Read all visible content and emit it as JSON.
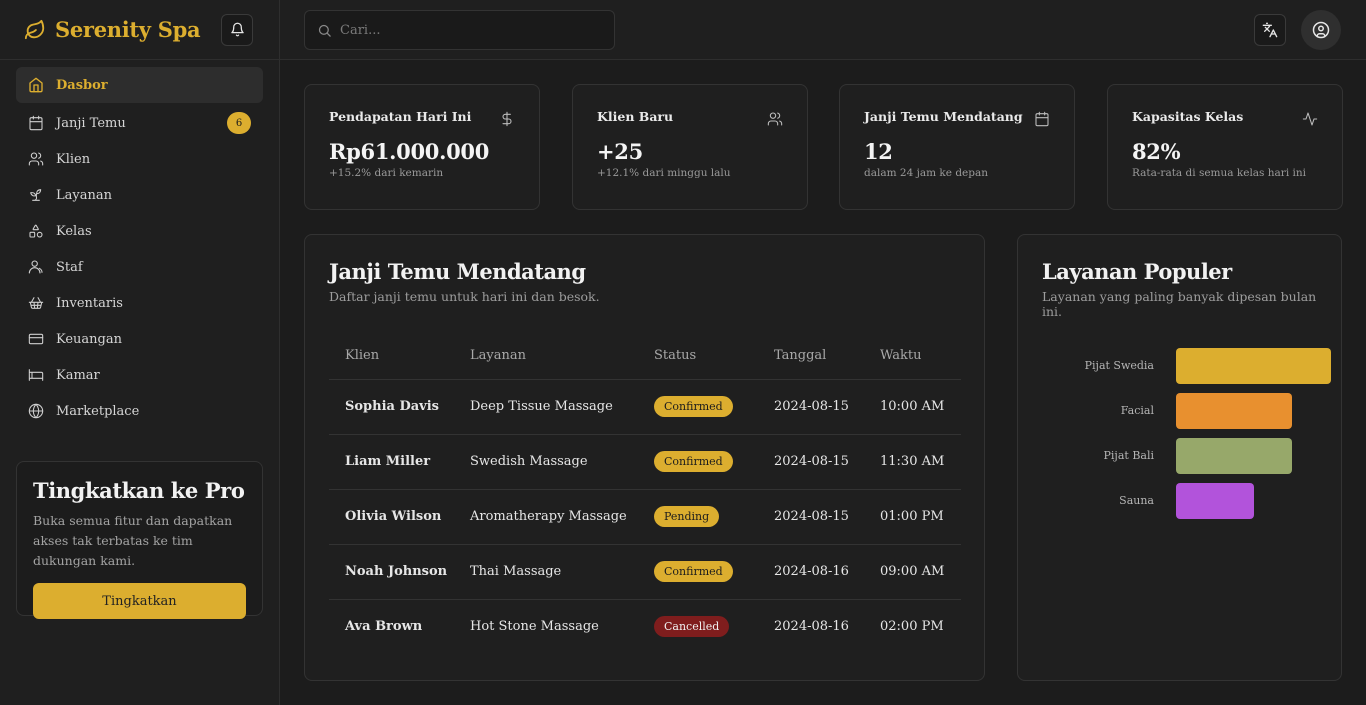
{
  "brand": {
    "name": "Serenity Spa"
  },
  "sidebar": {
    "items": [
      {
        "label": "Dasbor",
        "icon": "home-icon",
        "active": true
      },
      {
        "label": "Janji Temu",
        "icon": "calendar-icon",
        "badge": "6"
      },
      {
        "label": "Klien",
        "icon": "users-icon"
      },
      {
        "label": "Layanan",
        "icon": "sprout-icon"
      },
      {
        "label": "Kelas",
        "icon": "shapes-icon"
      },
      {
        "label": "Staf",
        "icon": "user-icon"
      },
      {
        "label": "Inventaris",
        "icon": "basket-icon"
      },
      {
        "label": "Keuangan",
        "icon": "credit-card-icon"
      },
      {
        "label": "Kamar",
        "icon": "bed-icon"
      },
      {
        "label": "Marketplace",
        "icon": "globe-icon"
      }
    ],
    "pro": {
      "title": "Tingkatkan ke Pro",
      "description": "Buka semua fitur dan dapatkan akses tak terbatas ke tim dukungan kami.",
      "button": "Tingkatkan"
    }
  },
  "topbar": {
    "search_placeholder": "Cari..."
  },
  "stats": [
    {
      "label": "Pendapatan Hari Ini",
      "icon": "dollar-icon",
      "value": "Rp61.000.000",
      "sub": "+15.2% dari kemarin"
    },
    {
      "label": "Klien Baru",
      "icon": "users-icon",
      "value": "+25",
      "sub": "+12.1% dari minggu lalu"
    },
    {
      "label": "Janji Temu Mendatang",
      "icon": "calendar-icon",
      "value": "12",
      "sub": "dalam 24 jam ke depan"
    },
    {
      "label": "Kapasitas Kelas",
      "icon": "activity-icon",
      "value": "82%",
      "sub": "Rata-rata di semua kelas hari ini"
    }
  ],
  "appointments": {
    "title": "Janji Temu Mendatang",
    "description": "Daftar janji temu untuk hari ini dan besok.",
    "columns": [
      "Klien",
      "Layanan",
      "Status",
      "Tanggal",
      "Waktu"
    ],
    "rows": [
      {
        "client": "Sophia Davis",
        "service": "Deep Tissue Massage",
        "status": "Confirmed",
        "date": "2024-08-15",
        "time": "10:00 AM"
      },
      {
        "client": "Liam Miller",
        "service": "Swedish Massage",
        "status": "Confirmed",
        "date": "2024-08-15",
        "time": "11:30 AM"
      },
      {
        "client": "Olivia Wilson",
        "service": "Aromatherapy Massage",
        "status": "Pending",
        "date": "2024-08-15",
        "time": "01:00 PM"
      },
      {
        "client": "Noah Johnson",
        "service": "Thai Massage",
        "status": "Confirmed",
        "date": "2024-08-16",
        "time": "09:00 AM"
      },
      {
        "client": "Ava Brown",
        "service": "Hot Stone Massage",
        "status": "Cancelled",
        "date": "2024-08-16",
        "time": "02:00 PM"
      }
    ],
    "status_colors": {
      "Confirmed": "#dcae2f",
      "Pending": "#dcae2f",
      "Cancelled": "#7f1d1d"
    }
  },
  "popular": {
    "title": "Layanan Populer",
    "description": "Layanan yang paling banyak dipesan bulan ini."
  },
  "chart_data": {
    "type": "bar",
    "orientation": "horizontal",
    "categories": [
      "Pijat Swedia",
      "Facial",
      "Pijat Bali",
      "Sauna"
    ],
    "values": [
      100,
      75,
      75,
      50
    ],
    "colors": [
      "#dcae2f",
      "#e8902f",
      "#97a86a",
      "#b253db"
    ],
    "xlim": [
      0,
      100
    ],
    "grid": false
  },
  "colors": {
    "accent": "#dcae2f",
    "background": "#1c1c1c"
  }
}
